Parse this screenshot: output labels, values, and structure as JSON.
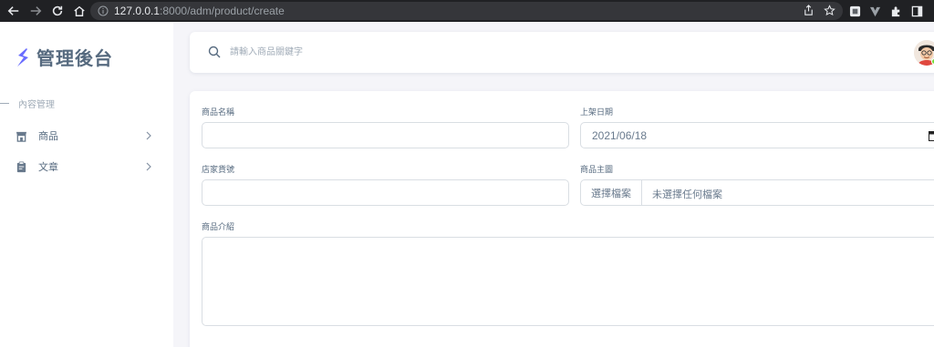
{
  "browser": {
    "url_host": "127.0.0.1",
    "url_path": ":8000/adm/product/create"
  },
  "sidebar": {
    "brand": "管理後台",
    "section_header": "內容管理",
    "items": [
      {
        "label": "商品",
        "icon": "store-icon"
      },
      {
        "label": "文章",
        "icon": "clipboard-icon"
      }
    ]
  },
  "navbar": {
    "search_placeholder": "請輸入商品關鍵字"
  },
  "form": {
    "product_name_label": "商品名稱",
    "product_name_value": "",
    "release_date_label": "上架日期",
    "release_date_value": "2021/06/18",
    "store_sku_label": "店家貨號",
    "store_sku_value": "",
    "main_image_label": "商品主圖",
    "file_button_label": "選擇檔案",
    "file_status": "未選擇任何檔案",
    "description_label": "商品介紹",
    "description_value": ""
  },
  "colors": {
    "accent": "#696cff",
    "text": "#566a7f",
    "muted": "#a1acb8",
    "border": "#d9dee3",
    "status_online": "#71dd37"
  }
}
